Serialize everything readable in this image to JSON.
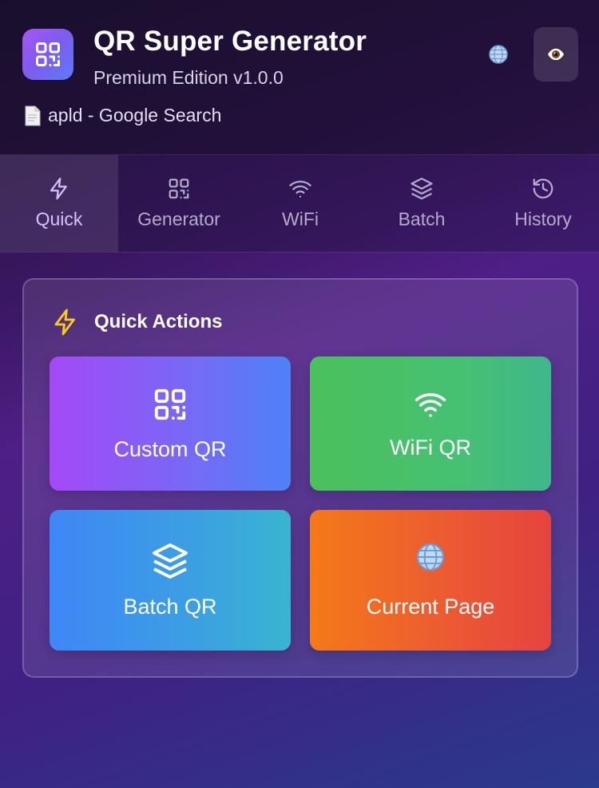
{
  "header": {
    "title": "QR Super Generator",
    "subtitle": "Premium Edition v1.0.0",
    "page_title": "apld - Google Search",
    "logo_icon": "qr-code-icon",
    "language_icon": "globe-icon",
    "preview_icon": "eye-icon"
  },
  "tabs": [
    {
      "label": "Quick",
      "icon": "lightning-icon",
      "active": true
    },
    {
      "label": "Generator",
      "icon": "qr-code-icon",
      "active": false
    },
    {
      "label": "WiFi",
      "icon": "wifi-icon",
      "active": false
    },
    {
      "label": "Batch",
      "icon": "layers-icon",
      "active": false
    },
    {
      "label": "History",
      "icon": "history-icon",
      "active": false
    }
  ],
  "quick_actions": {
    "title": "Quick Actions",
    "items": [
      {
        "label": "Custom QR",
        "icon": "qr-code-icon"
      },
      {
        "label": "WiFi QR",
        "icon": "wifi-icon"
      },
      {
        "label": "Batch QR",
        "icon": "layers-icon"
      },
      {
        "label": "Current Page",
        "icon": "globe-icon"
      }
    ]
  },
  "colors": {
    "accent_purple": "#a855f7",
    "active_tab_text": "#d7c2ff",
    "lightning_yellow": "#facc15"
  }
}
